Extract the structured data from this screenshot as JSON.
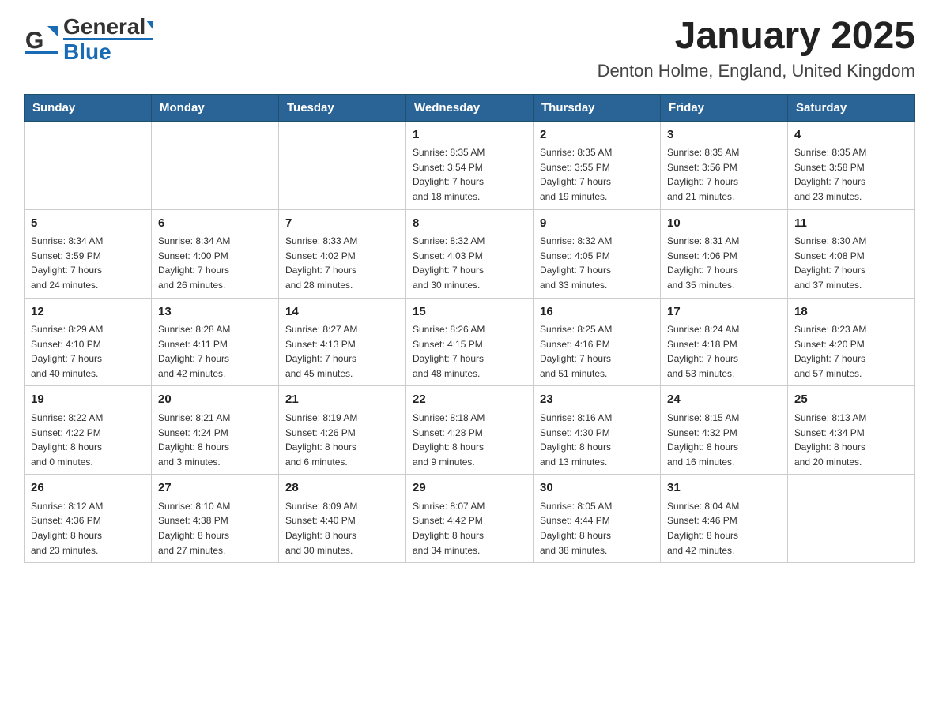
{
  "header": {
    "logo_general": "General",
    "logo_blue": "Blue",
    "month_title": "January 2025",
    "location": "Denton Holme, England, United Kingdom"
  },
  "weekdays": [
    "Sunday",
    "Monday",
    "Tuesday",
    "Wednesday",
    "Thursday",
    "Friday",
    "Saturday"
  ],
  "weeks": [
    [
      {
        "day": "",
        "info": ""
      },
      {
        "day": "",
        "info": ""
      },
      {
        "day": "",
        "info": ""
      },
      {
        "day": "1",
        "info": "Sunrise: 8:35 AM\nSunset: 3:54 PM\nDaylight: 7 hours\nand 18 minutes."
      },
      {
        "day": "2",
        "info": "Sunrise: 8:35 AM\nSunset: 3:55 PM\nDaylight: 7 hours\nand 19 minutes."
      },
      {
        "day": "3",
        "info": "Sunrise: 8:35 AM\nSunset: 3:56 PM\nDaylight: 7 hours\nand 21 minutes."
      },
      {
        "day": "4",
        "info": "Sunrise: 8:35 AM\nSunset: 3:58 PM\nDaylight: 7 hours\nand 23 minutes."
      }
    ],
    [
      {
        "day": "5",
        "info": "Sunrise: 8:34 AM\nSunset: 3:59 PM\nDaylight: 7 hours\nand 24 minutes."
      },
      {
        "day": "6",
        "info": "Sunrise: 8:34 AM\nSunset: 4:00 PM\nDaylight: 7 hours\nand 26 minutes."
      },
      {
        "day": "7",
        "info": "Sunrise: 8:33 AM\nSunset: 4:02 PM\nDaylight: 7 hours\nand 28 minutes."
      },
      {
        "day": "8",
        "info": "Sunrise: 8:32 AM\nSunset: 4:03 PM\nDaylight: 7 hours\nand 30 minutes."
      },
      {
        "day": "9",
        "info": "Sunrise: 8:32 AM\nSunset: 4:05 PM\nDaylight: 7 hours\nand 33 minutes."
      },
      {
        "day": "10",
        "info": "Sunrise: 8:31 AM\nSunset: 4:06 PM\nDaylight: 7 hours\nand 35 minutes."
      },
      {
        "day": "11",
        "info": "Sunrise: 8:30 AM\nSunset: 4:08 PM\nDaylight: 7 hours\nand 37 minutes."
      }
    ],
    [
      {
        "day": "12",
        "info": "Sunrise: 8:29 AM\nSunset: 4:10 PM\nDaylight: 7 hours\nand 40 minutes."
      },
      {
        "day": "13",
        "info": "Sunrise: 8:28 AM\nSunset: 4:11 PM\nDaylight: 7 hours\nand 42 minutes."
      },
      {
        "day": "14",
        "info": "Sunrise: 8:27 AM\nSunset: 4:13 PM\nDaylight: 7 hours\nand 45 minutes."
      },
      {
        "day": "15",
        "info": "Sunrise: 8:26 AM\nSunset: 4:15 PM\nDaylight: 7 hours\nand 48 minutes."
      },
      {
        "day": "16",
        "info": "Sunrise: 8:25 AM\nSunset: 4:16 PM\nDaylight: 7 hours\nand 51 minutes."
      },
      {
        "day": "17",
        "info": "Sunrise: 8:24 AM\nSunset: 4:18 PM\nDaylight: 7 hours\nand 53 minutes."
      },
      {
        "day": "18",
        "info": "Sunrise: 8:23 AM\nSunset: 4:20 PM\nDaylight: 7 hours\nand 57 minutes."
      }
    ],
    [
      {
        "day": "19",
        "info": "Sunrise: 8:22 AM\nSunset: 4:22 PM\nDaylight: 8 hours\nand 0 minutes."
      },
      {
        "day": "20",
        "info": "Sunrise: 8:21 AM\nSunset: 4:24 PM\nDaylight: 8 hours\nand 3 minutes."
      },
      {
        "day": "21",
        "info": "Sunrise: 8:19 AM\nSunset: 4:26 PM\nDaylight: 8 hours\nand 6 minutes."
      },
      {
        "day": "22",
        "info": "Sunrise: 8:18 AM\nSunset: 4:28 PM\nDaylight: 8 hours\nand 9 minutes."
      },
      {
        "day": "23",
        "info": "Sunrise: 8:16 AM\nSunset: 4:30 PM\nDaylight: 8 hours\nand 13 minutes."
      },
      {
        "day": "24",
        "info": "Sunrise: 8:15 AM\nSunset: 4:32 PM\nDaylight: 8 hours\nand 16 minutes."
      },
      {
        "day": "25",
        "info": "Sunrise: 8:13 AM\nSunset: 4:34 PM\nDaylight: 8 hours\nand 20 minutes."
      }
    ],
    [
      {
        "day": "26",
        "info": "Sunrise: 8:12 AM\nSunset: 4:36 PM\nDaylight: 8 hours\nand 23 minutes."
      },
      {
        "day": "27",
        "info": "Sunrise: 8:10 AM\nSunset: 4:38 PM\nDaylight: 8 hours\nand 27 minutes."
      },
      {
        "day": "28",
        "info": "Sunrise: 8:09 AM\nSunset: 4:40 PM\nDaylight: 8 hours\nand 30 minutes."
      },
      {
        "day": "29",
        "info": "Sunrise: 8:07 AM\nSunset: 4:42 PM\nDaylight: 8 hours\nand 34 minutes."
      },
      {
        "day": "30",
        "info": "Sunrise: 8:05 AM\nSunset: 4:44 PM\nDaylight: 8 hours\nand 38 minutes."
      },
      {
        "day": "31",
        "info": "Sunrise: 8:04 AM\nSunset: 4:46 PM\nDaylight: 8 hours\nand 42 minutes."
      },
      {
        "day": "",
        "info": ""
      }
    ]
  ]
}
